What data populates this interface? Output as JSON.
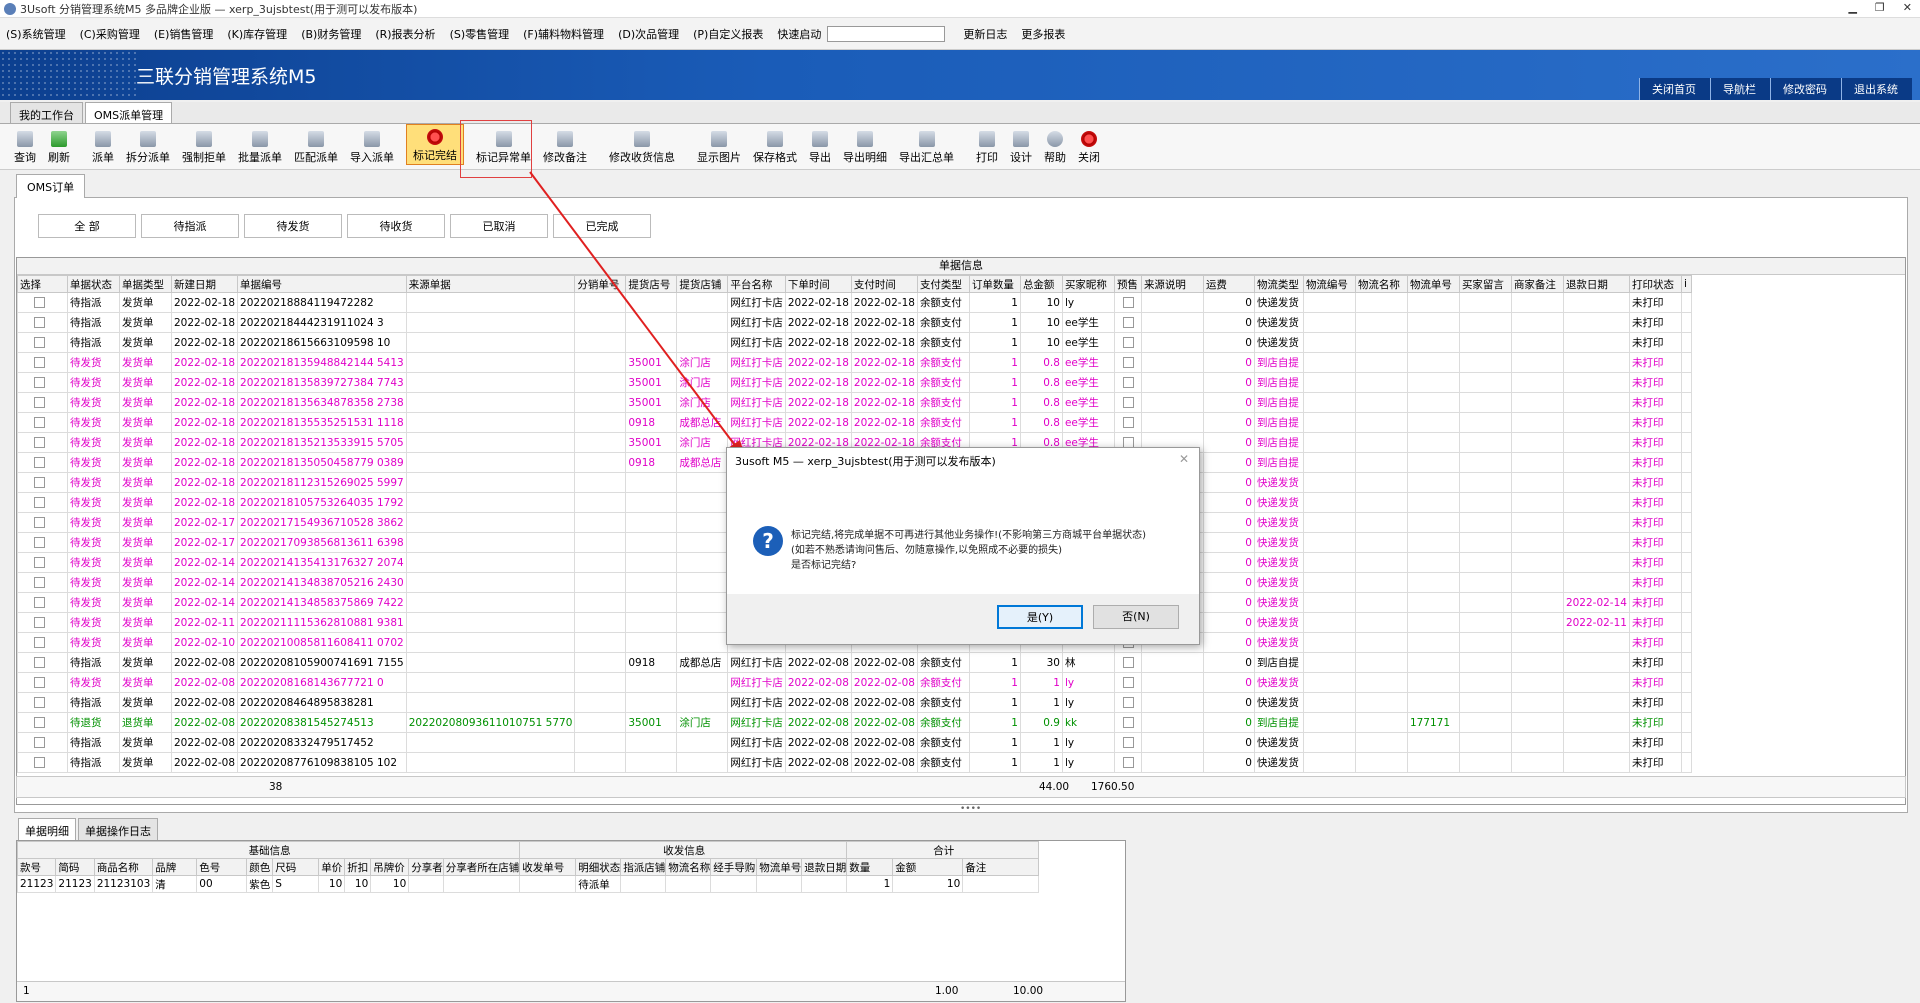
{
  "window": {
    "title": "3Usoft 分销管理系统M5 多品牌企业版 — xerp_3ujsbtest(用于测可以发布版本)",
    "controls": [
      "▁",
      "❐",
      "✕"
    ]
  },
  "menu": {
    "items": [
      "(S)系统管理",
      "(C)采购管理",
      "(E)销售管理",
      "(K)库存管理",
      "(B)财务管理",
      "(R)报表分析",
      "(S)零售管理",
      "(F)辅料物料管理",
      "(D)次品管理",
      "(P)自定义报表"
    ],
    "quick_start_label": "快速启动",
    "quick_start_value": "",
    "extra": [
      "更新日志",
      "更多报表"
    ]
  },
  "banner": {
    "app_title": "三联分销管理系统M5",
    "links": [
      "关闭首页",
      "导航栏",
      "修改密码",
      "退出系统"
    ]
  },
  "top_tabs": [
    "我的工作台",
    "OMS派单管理"
  ],
  "toolbar": {
    "buttons": [
      {
        "label": "查询",
        "icon": "query-icon"
      },
      {
        "label": "刷新",
        "icon": "refresh-icon"
      },
      {
        "label": "派单",
        "icon": "dispatch-icon"
      },
      {
        "label": "拆分派单",
        "icon": "split-icon"
      },
      {
        "label": "强制拒单",
        "icon": "reject-icon"
      },
      {
        "label": "批量派单",
        "icon": "batch-icon"
      },
      {
        "label": "匹配派单",
        "icon": "match-icon"
      },
      {
        "label": "导入派单",
        "icon": "import-icon"
      },
      {
        "label": "标记完结",
        "icon": "mark-complete-icon"
      },
      {
        "label": "标记异常单",
        "icon": "mark-abnormal-icon"
      },
      {
        "label": "修改备注",
        "icon": "edit-note-icon"
      },
      {
        "label": "修改收货信息",
        "icon": "edit-receive-icon"
      },
      {
        "label": "显示图片",
        "icon": "image-icon"
      },
      {
        "label": "保存格式",
        "icon": "save-format-icon"
      },
      {
        "label": "导出",
        "icon": "export-icon"
      },
      {
        "label": "导出明细",
        "icon": "export-detail-icon"
      },
      {
        "label": "导出汇总单",
        "icon": "export-summary-icon"
      },
      {
        "label": "打印",
        "icon": "print-icon"
      },
      {
        "label": "设计",
        "icon": "design-icon"
      },
      {
        "label": "帮助",
        "icon": "help-icon"
      },
      {
        "label": "关闭",
        "icon": "close-icon"
      }
    ]
  },
  "sub_tab": "OMS订单",
  "filters": [
    "全 部",
    "待指派",
    "待发货",
    "待收货",
    "已取消",
    "已完成"
  ],
  "grid": {
    "group_header": "单据信息",
    "columns": [
      "选择",
      "单据状态",
      "单据类型",
      "新建日期",
      "单据编号",
      "来源单据",
      "分销单号",
      "提货店号",
      "提货店铺",
      "平台名称",
      "下单时间",
      "支付时间",
      "支付类型",
      "订单数量",
      "总金额",
      "买家昵称",
      "预售",
      "来源说明",
      "运费",
      "物流类型",
      "物流编号",
      "物流名称",
      "物流单号",
      "买家留言",
      "商家备注",
      "退款日期",
      "打印状态",
      "i"
    ],
    "rows": [
      {
        "style": "",
        "c": [
          "待指派",
          "发货单",
          "2022-02-18",
          "20220218884119472282",
          "",
          "",
          "",
          "",
          "网红打卡店",
          "2022-02-18",
          "2022-02-18",
          "余额支付",
          "1",
          "10",
          "ly",
          "",
          "",
          "0",
          "快递发货",
          "",
          "",
          "",
          "",
          "",
          "",
          "未打印"
        ]
      },
      {
        "style": "",
        "c": [
          "待指派",
          "发货单",
          "2022-02-18",
          "20220218444231911024 3",
          "",
          "",
          "",
          "",
          "网红打卡店",
          "2022-02-18",
          "2022-02-18",
          "余额支付",
          "1",
          "10",
          "ee学生",
          "",
          "",
          "0",
          "快递发货",
          "",
          "",
          "",
          "",
          "",
          "",
          "未打印"
        ]
      },
      {
        "style": "",
        "c": [
          "待指派",
          "发货单",
          "2022-02-18",
          "20220218615663109598 10",
          "",
          "",
          "",
          "",
          "网红打卡店",
          "2022-02-18",
          "2022-02-18",
          "余额支付",
          "1",
          "10",
          "ee学生",
          "",
          "",
          "0",
          "快递发货",
          "",
          "",
          "",
          "",
          "",
          "",
          "未打印"
        ]
      },
      {
        "style": "pink",
        "c": [
          "待发货",
          "发货单",
          "2022-02-18",
          "20220218135948842144 5413",
          "",
          "",
          "35001",
          "涂门店",
          "网红打卡店",
          "2022-02-18",
          "2022-02-18",
          "余额支付",
          "1",
          "0.8",
          "ee学生",
          "",
          "",
          "0",
          "到店自提",
          "",
          "",
          "",
          "",
          "",
          "",
          "未打印"
        ]
      },
      {
        "style": "pink",
        "c": [
          "待发货",
          "发货单",
          "2022-02-18",
          "20220218135839727384 7743",
          "",
          "",
          "35001",
          "涂门店",
          "网红打卡店",
          "2022-02-18",
          "2022-02-18",
          "余额支付",
          "1",
          "0.8",
          "ee学生",
          "",
          "",
          "0",
          "到店自提",
          "",
          "",
          "",
          "",
          "",
          "",
          "未打印"
        ]
      },
      {
        "style": "pink",
        "c": [
          "待发货",
          "发货单",
          "2022-02-18",
          "20220218135634878358 2738",
          "",
          "",
          "35001",
          "涂门店",
          "网红打卡店",
          "2022-02-18",
          "2022-02-18",
          "余额支付",
          "1",
          "0.8",
          "ee学生",
          "",
          "",
          "0",
          "到店自提",
          "",
          "",
          "",
          "",
          "",
          "",
          "未打印"
        ]
      },
      {
        "style": "pink",
        "c": [
          "待发货",
          "发货单",
          "2022-02-18",
          "20220218135535251531 1118",
          "",
          "",
          "0918",
          "成都总店",
          "网红打卡店",
          "2022-02-18",
          "2022-02-18",
          "余额支付",
          "1",
          "0.8",
          "ee学生",
          "",
          "",
          "0",
          "到店自提",
          "",
          "",
          "",
          "",
          "",
          "",
          "未打印"
        ]
      },
      {
        "style": "pink",
        "c": [
          "待发货",
          "发货单",
          "2022-02-18",
          "20220218135213533915 5705",
          "",
          "",
          "35001",
          "涂门店",
          "网红打卡店",
          "2022-02-18",
          "2022-02-18",
          "余额支付",
          "1",
          "0.8",
          "ee学生",
          "",
          "",
          "0",
          "到店自提",
          "",
          "",
          "",
          "",
          "",
          "",
          "未打印"
        ]
      },
      {
        "style": "pink",
        "c": [
          "待发货",
          "发货单",
          "2022-02-18",
          "20220218135050458779 0389",
          "",
          "",
          "0918",
          "成都总店",
          "网红打卡店",
          "",
          "",
          "",
          "",
          "",
          "",
          "",
          "",
          "0",
          "到店自提",
          "",
          "",
          "",
          "",
          "",
          "",
          "未打印"
        ]
      },
      {
        "style": "pink",
        "c": [
          "待发货",
          "发货单",
          "2022-02-18",
          "20220218112315269025 5997",
          "",
          "",
          "",
          "",
          "",
          "",
          "",
          "",
          "",
          "",
          "",
          "",
          "",
          "0",
          "快递发货",
          "",
          "",
          "",
          "",
          "",
          "",
          "未打印"
        ]
      },
      {
        "style": "pink",
        "c": [
          "待发货",
          "发货单",
          "2022-02-18",
          "20220218105753264035 1792",
          "",
          "",
          "",
          "",
          "",
          "",
          "",
          "",
          "",
          "",
          "",
          "",
          "",
          "0",
          "快递发货",
          "",
          "",
          "",
          "",
          "",
          "",
          "未打印"
        ]
      },
      {
        "style": "pink",
        "c": [
          "待发货",
          "发货单",
          "2022-02-17",
          "20220217154936710528 3862",
          "",
          "",
          "",
          "",
          "",
          "",
          "",
          "",
          "",
          "",
          "",
          "",
          "",
          "0",
          "快递发货",
          "",
          "",
          "",
          "",
          "",
          "",
          "未打印"
        ]
      },
      {
        "style": "pink",
        "c": [
          "待发货",
          "发货单",
          "2022-02-17",
          "20220217093856813611 6398",
          "",
          "",
          "",
          "",
          "",
          "",
          "",
          "",
          "",
          "",
          "",
          "",
          "",
          "0",
          "快递发货",
          "",
          "",
          "",
          "",
          "",
          "",
          "未打印"
        ]
      },
      {
        "style": "pink",
        "c": [
          "待发货",
          "发货单",
          "2022-02-14",
          "20220214135413176327 2074",
          "",
          "",
          "",
          "",
          "",
          "",
          "",
          "",
          "",
          "",
          "",
          "",
          "",
          "0",
          "快递发货",
          "",
          "",
          "",
          "",
          "",
          "",
          "未打印"
        ]
      },
      {
        "style": "pink",
        "c": [
          "待发货",
          "发货单",
          "2022-02-14",
          "20220214134838705216 2430",
          "",
          "",
          "",
          "",
          "",
          "",
          "",
          "",
          "",
          "",
          "",
          "",
          "",
          "0",
          "快递发货",
          "",
          "",
          "",
          "",
          "",
          "",
          "未打印"
        ]
      },
      {
        "style": "pink",
        "c": [
          "待发货",
          "发货单",
          "2022-02-14",
          "20220214134858375869 7422",
          "",
          "",
          "",
          "",
          "",
          "",
          "",
          "",
          "",
          "",
          "",
          "",
          "",
          "0",
          "快递发货",
          "",
          "",
          "",
          "",
          "",
          "2022-02-14",
          "未打印"
        ]
      },
      {
        "style": "pink",
        "c": [
          "待发货",
          "发货单",
          "2022-02-11",
          "20220211115362810881 9381",
          "",
          "",
          "",
          "",
          "",
          "",
          "",
          "",
          "",
          "",
          "",
          "",
          "",
          "0",
          "快递发货",
          "",
          "",
          "",
          "",
          "",
          "2022-02-11",
          "未打印"
        ]
      },
      {
        "style": "pink",
        "c": [
          "待发货",
          "发货单",
          "2022-02-10",
          "20220210085811608411 0702",
          "",
          "",
          "",
          "",
          "",
          "",
          "",
          "",
          "",
          "",
          "",
          "",
          "",
          "0",
          "快递发货",
          "",
          "",
          "",
          "",
          "",
          "",
          "未打印"
        ]
      },
      {
        "style": "",
        "c": [
          "待指派",
          "发货单",
          "2022-02-08",
          "20220208105900741691 7155",
          "",
          "",
          "0918",
          "成都总店",
          "网红打卡店",
          "2022-02-08",
          "2022-02-08",
          "余额支付",
          "1",
          "30",
          "林",
          "",
          "",
          "0",
          "到店自提",
          "",
          "",
          "",
          "",
          "",
          "",
          "未打印"
        ]
      },
      {
        "style": "pink",
        "c": [
          "待发货",
          "发货单",
          "2022-02-08",
          "20220208168143677721 0",
          "",
          "",
          "",
          "",
          "网红打卡店",
          "2022-02-08",
          "2022-02-08",
          "余额支付",
          "1",
          "1",
          "ly",
          "",
          "",
          "0",
          "快递发货",
          "",
          "",
          "",
          "",
          "",
          "",
          "未打印"
        ]
      },
      {
        "style": "",
        "c": [
          "待指派",
          "发货单",
          "2022-02-08",
          "20220208464895838281",
          "",
          "",
          "",
          "",
          "网红打卡店",
          "2022-02-08",
          "2022-02-08",
          "余额支付",
          "1",
          "1",
          "ly",
          "",
          "",
          "0",
          "快递发货",
          "",
          "",
          "",
          "",
          "",
          "",
          "未打印"
        ]
      },
      {
        "style": "green",
        "c": [
          "待退货",
          "退货单",
          "2022-02-08",
          "20220208381545274513",
          "20220208093611010751 5770",
          "",
          "35001",
          "涂门店",
          "网红打卡店",
          "2022-02-08",
          "2022-02-08",
          "余额支付",
          "1",
          "0.9",
          "kk",
          "",
          "",
          "0",
          "到店自提",
          "",
          "",
          "177171",
          "",
          "",
          "",
          "未打印"
        ]
      },
      {
        "style": "",
        "c": [
          "待指派",
          "发货单",
          "2022-02-08",
          "20220208332479517452",
          "",
          "",
          "",
          "",
          "网红打卡店",
          "2022-02-08",
          "2022-02-08",
          "余额支付",
          "1",
          "1",
          "ly",
          "",
          "",
          "0",
          "快递发货",
          "",
          "",
          "",
          "",
          "",
          "",
          "未打印"
        ]
      },
      {
        "style": "",
        "c": [
          "待指派",
          "发货单",
          "2022-02-08",
          "20220208776109838105 102",
          "",
          "",
          "",
          "",
          "网红打卡店",
          "2022-02-08",
          "2022-02-08",
          "余额支付",
          "1",
          "1",
          "ly",
          "",
          "",
          "0",
          "快递发货",
          "",
          "",
          "",
          "",
          "",
          "",
          "未打印"
        ]
      }
    ],
    "footer": {
      "count": "38",
      "qty": "44.00",
      "amount": "1760.50"
    }
  },
  "bottom": {
    "tabs": [
      "单据明细",
      "单据操作日志"
    ],
    "groups": [
      "基础信息",
      "收发信息",
      "合计"
    ],
    "columns": [
      "款号",
      "简码",
      "商品名称",
      "品牌",
      "色号",
      "颜色",
      "尺码",
      "单价",
      "折扣",
      "吊牌价",
      "分享者",
      "分享者所在店铺",
      "收发单号",
      "明细状态",
      "指派店铺",
      "物流名称",
      "经手导购",
      "物流单号",
      "退款日期",
      "数量",
      "金额",
      "备注"
    ],
    "rows": [
      [
        "21123",
        "21123",
        "21123103",
        "清",
        "00",
        "紫色",
        "S",
        "10",
        "10",
        "10",
        "",
        "",
        "",
        "待派单",
        "",
        "",
        "",
        "",
        "",
        "1",
        "10",
        ""
      ]
    ],
    "footer": {
      "count": "1",
      "qty": "1.00",
      "amount": "10.00"
    }
  },
  "dialog": {
    "title": "3usoft M5 — xerp_3ujsbtest(用于测可以发布版本)",
    "message_line1": "标记完结,将完成单据不可再进行其他业务操作!(不影响第三方商城平台单据状态)",
    "message_line2": "(如若不熟悉请询问售后、勿随意操作,以免照成不必要的损失)",
    "message_line3": "是否标记完结?",
    "yes": "是(Y)",
    "no": "否(N)",
    "close": "✕"
  }
}
